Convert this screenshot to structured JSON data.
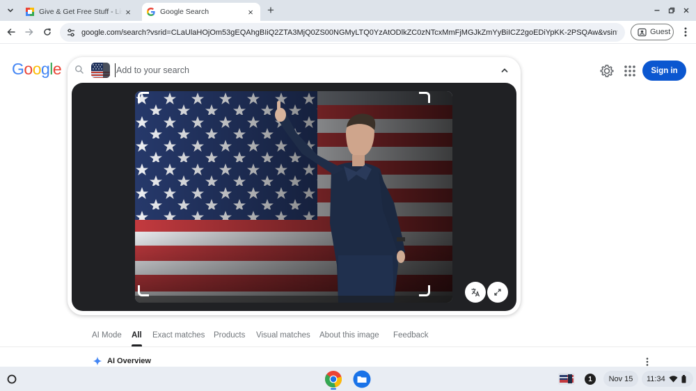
{
  "browser": {
    "tabs": [
      {
        "title": "Give & Get Free Stuff - Listia.com",
        "close": "×"
      },
      {
        "title": "Google Search",
        "close": "×"
      }
    ],
    "new_tab": "+",
    "url": "google.com/search?vsrid=CLaUlaHOjOm53gEQAhgBIiQ2ZTA3MjQ0ZS00NGMyLTQ0YzAtODlkZC0zNTcxMmFjMGJkZmYyBiICZ2goEDiYpKK-2PSQAw&vsint=CAIqDAoC...",
    "profile_label": "Guest"
  },
  "google": {
    "logo_letters": [
      {
        "ch": "G",
        "color": "#4285f4"
      },
      {
        "ch": "o",
        "color": "#ea4335"
      },
      {
        "ch": "o",
        "color": "#fbbc05"
      },
      {
        "ch": "g",
        "color": "#4285f4"
      },
      {
        "ch": "l",
        "color": "#34a853"
      },
      {
        "ch": "e",
        "color": "#ea4335"
      }
    ],
    "search_placeholder": "Add to your search",
    "sign_in_label": "Sign in",
    "accent_color": "#0b57d0"
  },
  "filters": [
    {
      "label": "AI Mode",
      "active": false
    },
    {
      "label": "All",
      "active": true
    },
    {
      "label": "Exact matches",
      "active": false
    },
    {
      "label": "Products",
      "active": false
    },
    {
      "label": "Visual matches",
      "active": false
    },
    {
      "label": "About this image",
      "active": false
    },
    {
      "label": "Feedback",
      "active": false
    }
  ],
  "ai_overview": {
    "label": "AI Overview"
  },
  "shelf": {
    "notification_count": "1",
    "date": "Nov 15",
    "time": "11:34"
  }
}
